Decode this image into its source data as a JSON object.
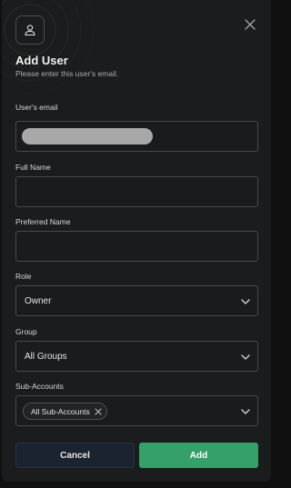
{
  "header": {
    "title": "Add User",
    "subtitle": "Please enter this user's email."
  },
  "icons": {
    "header": "user-icon",
    "close": "close-icon",
    "chevron": "chevron-down-icon",
    "chip_remove": "close-icon"
  },
  "form": {
    "email": {
      "label": "User's email",
      "value": ""
    },
    "full_name": {
      "label": "Full Name",
      "value": ""
    },
    "preferred_name": {
      "label": "Preferred Name",
      "value": ""
    },
    "role": {
      "label": "Role",
      "value": "Owner"
    },
    "group": {
      "label": "Group",
      "value": "All Groups"
    },
    "sub_accounts": {
      "label": "Sub-Accounts",
      "chips": [
        "All Sub-Accounts"
      ]
    }
  },
  "actions": {
    "cancel_label": "Cancel",
    "add_label": "Add"
  },
  "colors": {
    "modal_bg": "#1b1c1d",
    "accent_green": "#36a06b",
    "cancel_bg": "#1c2330",
    "field_border": "#48494c"
  }
}
